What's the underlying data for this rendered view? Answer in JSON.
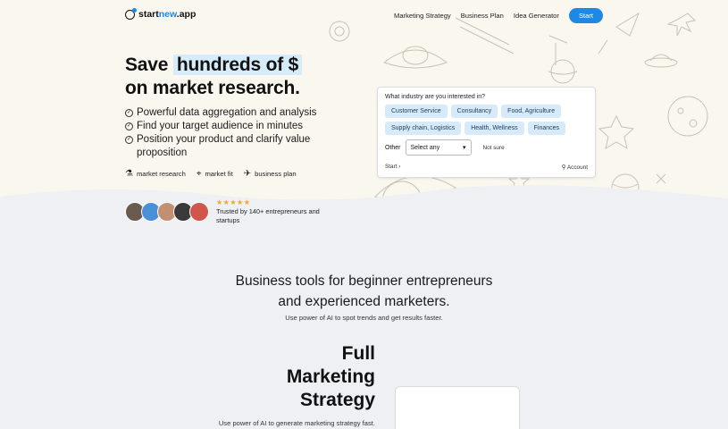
{
  "brand": {
    "name_prefix": "start",
    "name_accent": "new",
    "name_suffix": ".app",
    "accent_color": "#1e88e5"
  },
  "nav": {
    "links": [
      "Marketing Strategy",
      "Business Plan",
      "Idea Generator"
    ],
    "cta": "Start"
  },
  "hero": {
    "headline_pre": "Save ",
    "headline_highlight": "hundreds of $",
    "headline_line2": "on market research.",
    "bullets": [
      "Powerful data aggregation and analysis",
      "Find your target audience in minutes",
      "Position your product and clarify value proposition"
    ],
    "tags": [
      {
        "icon": "analytics-icon",
        "label": "market research"
      },
      {
        "icon": "target-icon",
        "label": "market fit"
      },
      {
        "icon": "rocket-icon",
        "label": "business plan"
      }
    ],
    "stars": "★★★★★",
    "trusted": "Trusted by 140+ entrepreneurs and startups"
  },
  "industry_card": {
    "question": "What industry are you interested in?",
    "chips": [
      "Customer Service",
      "Consultancy",
      "Food, Agriculture",
      "Supply chain, Logistics",
      "Health, Wellness",
      "Finances"
    ],
    "other_label": "Other",
    "select_value": "Select any",
    "not_sure": "Not sure",
    "start_link": "Start",
    "account_link": "Account"
  },
  "section": {
    "title_line1": "Business tools for beginner entrepreneurs",
    "title_line2": "and experienced marketers.",
    "subtitle": "Use power of AI to spot trends and get results faster.",
    "feature_line1": "Full",
    "feature_line2": "Marketing",
    "feature_line3": "Strategy",
    "feature_sub": "Use power of AI to generate marketing strategy fast."
  }
}
